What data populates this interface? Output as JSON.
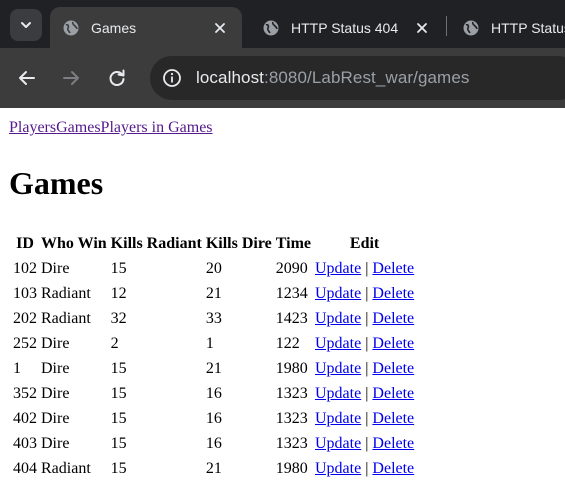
{
  "browser": {
    "tabs": [
      {
        "title": "Games",
        "active": true
      },
      {
        "title": "HTTP Status 404",
        "active": false
      },
      {
        "title": "HTTP Status",
        "active": false
      }
    ],
    "url_host": "localhost",
    "url_rest": ":8080/LabRest_war/games",
    "icons": {
      "tab_search": "chevron-down-icon",
      "favicon": "globe-icon",
      "close": "close-icon",
      "back": "back-arrow-icon",
      "forward": "forward-arrow-icon",
      "reload": "reload-icon",
      "site_info": "info-icon"
    },
    "colors": {
      "frame": "#202124",
      "toolbar": "#3c3c3c",
      "omnibox": "#282828",
      "text": "#e8eaed",
      "muted": "#9aa0a6"
    }
  },
  "nav": {
    "players": "Players",
    "games": "Games",
    "players_in_games": "Players in Games"
  },
  "page": {
    "title": "Games"
  },
  "table": {
    "headers": {
      "id": "ID",
      "who_win": "Who Win",
      "kills_radiant": "Kills Radiant",
      "kills_dire": "Kills Dire",
      "time": "Time",
      "edit": "Edit"
    },
    "update_label": "Update",
    "delete_label": "Delete",
    "separator": "|",
    "rows": [
      {
        "id": "102",
        "who_win": "Dire",
        "kills_radiant": "15",
        "kills_dire": "20",
        "time": "2090"
      },
      {
        "id": "103",
        "who_win": "Radiant",
        "kills_radiant": "12",
        "kills_dire": "21",
        "time": "1234"
      },
      {
        "id": "202",
        "who_win": "Radiant",
        "kills_radiant": "32",
        "kills_dire": "33",
        "time": "1423"
      },
      {
        "id": "252",
        "who_win": "Dire",
        "kills_radiant": "2",
        "kills_dire": "1",
        "time": "122"
      },
      {
        "id": "1",
        "who_win": "Dire",
        "kills_radiant": "15",
        "kills_dire": "21",
        "time": "1980"
      },
      {
        "id": "352",
        "who_win": "Dire",
        "kills_radiant": "15",
        "kills_dire": "16",
        "time": "1323"
      },
      {
        "id": "402",
        "who_win": "Dire",
        "kills_radiant": "15",
        "kills_dire": "16",
        "time": "1323"
      },
      {
        "id": "403",
        "who_win": "Dire",
        "kills_radiant": "15",
        "kills_dire": "16",
        "time": "1323"
      },
      {
        "id": "404",
        "who_win": "Radiant",
        "kills_radiant": "15",
        "kills_dire": "21",
        "time": "1980"
      }
    ]
  },
  "colors": {
    "visited_link": "#551a8b",
    "link": "#0000ee"
  }
}
